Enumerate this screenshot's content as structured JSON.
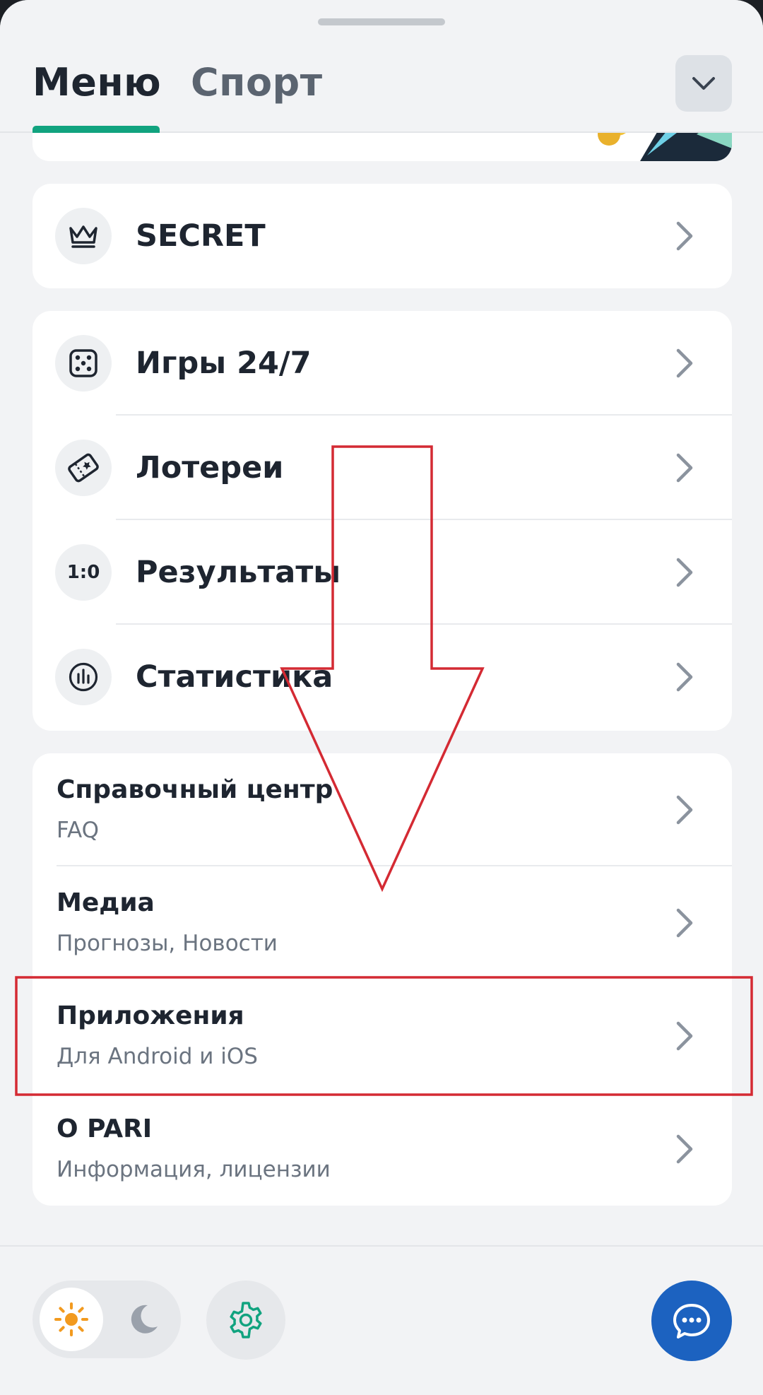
{
  "header": {
    "tabs": [
      {
        "label": "Меню",
        "active": true
      },
      {
        "label": "Спорт",
        "active": false
      }
    ],
    "accent_color": "#11a37f"
  },
  "nav_card_1": {
    "items": [
      {
        "label": "SECRET",
        "icon": "crown-icon"
      }
    ]
  },
  "nav_card_2": {
    "items": [
      {
        "label": "Игры 24/7",
        "icon": "dice-icon"
      },
      {
        "label": "Лотереи",
        "icon": "lottery-ticket-icon"
      },
      {
        "label": "Результаты",
        "icon": "score-icon",
        "icon_text": "1:0"
      },
      {
        "label": "Статистика",
        "icon": "bar-chart-icon"
      }
    ]
  },
  "info_card": {
    "items": [
      {
        "title": "Справочный центр",
        "subtitle": "FAQ"
      },
      {
        "title": "Медиа",
        "subtitle": "Прогнозы, Новости"
      },
      {
        "title": "Приложения",
        "subtitle": "Для Android и iOS"
      },
      {
        "title": "О PARI",
        "subtitle": "Информация, лицензии"
      }
    ]
  },
  "footer": {
    "theme": "light",
    "chat_color": "#1c62c0"
  },
  "annotation_color": "#d42a33"
}
